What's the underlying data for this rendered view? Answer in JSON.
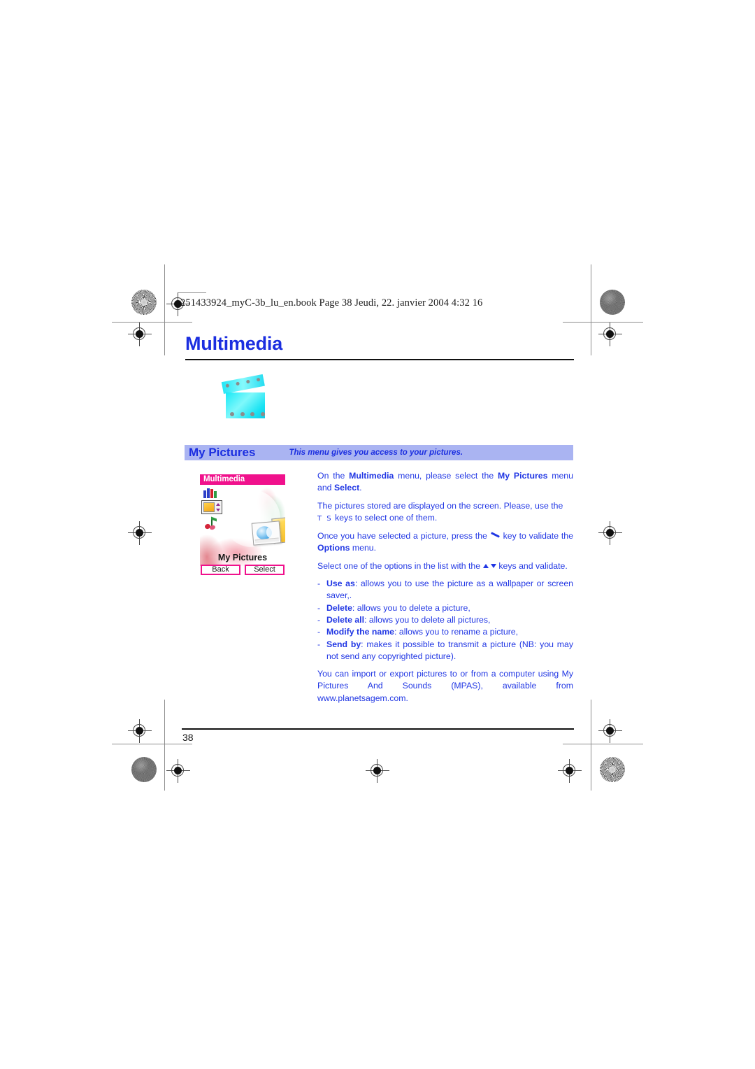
{
  "print": {
    "book_line": "251433924_myC-3b_lu_en.book  Page 38  Jeudi, 22. janvier 2004  4:32 16",
    "page_number": "38"
  },
  "chapter": {
    "title": "Multimedia",
    "title_color": "#1b2ee0",
    "icon": "clapperboard-icon"
  },
  "banner": {
    "title": "My Pictures",
    "caption": "This menu gives you access to your pictures.",
    "bg_color": "#aab4f2",
    "text_color": "#1b2ee0"
  },
  "phone_screen": {
    "title": "Multimedia",
    "title_bar_color": "#f0118c",
    "caption": "My Pictures",
    "softkey_left": "Back",
    "softkey_right": "Select",
    "icons": [
      "bar-chart-icon",
      "picture-frame-icon",
      "music-note-icon"
    ],
    "center_graphic": "two-photos-with-globe-icon"
  },
  "body": {
    "p1_a": "On the ",
    "p1_b": "Multimedia",
    "p1_c": " menu, please select the ",
    "p1_d": "My Pictures",
    "p1_e": " menu and ",
    "p1_f": "Select",
    "p1_g": ".",
    "p2_a": "The pictures stored are displayed on the screen. Please, use the",
    "p2_keys": "T S",
    "p2_b": "keys to select one of them.",
    "p3_a": "Once you have selected a picture, press the ",
    "p3_b": " key to validate the ",
    "p3_c": "Options",
    "p3_d": " menu.",
    "p4_a": "Select one of the options in the list with the",
    "p4_b": "keys and validate.",
    "bullet_dash": "-",
    "bullets": [
      {
        "label": "Use as",
        "text": ": allows you to use the picture as a wallpaper or screen saver,."
      },
      {
        "label": "Delete",
        "text": ": allows you to delete a picture,"
      },
      {
        "label": "Delete all",
        "text": ": allows you to delete all pictures,"
      },
      {
        "label": "Modify the name",
        "text": ": allows you to rename a picture,"
      },
      {
        "label": "Send by",
        "text": ": makes it possible to transmit a picture (NB: you may not send any copyrighted picture)."
      }
    ],
    "p5": "You can import or export pictures to or from a computer using My Pictures And Sounds (MPAS), available from www.planetsagem.com."
  }
}
